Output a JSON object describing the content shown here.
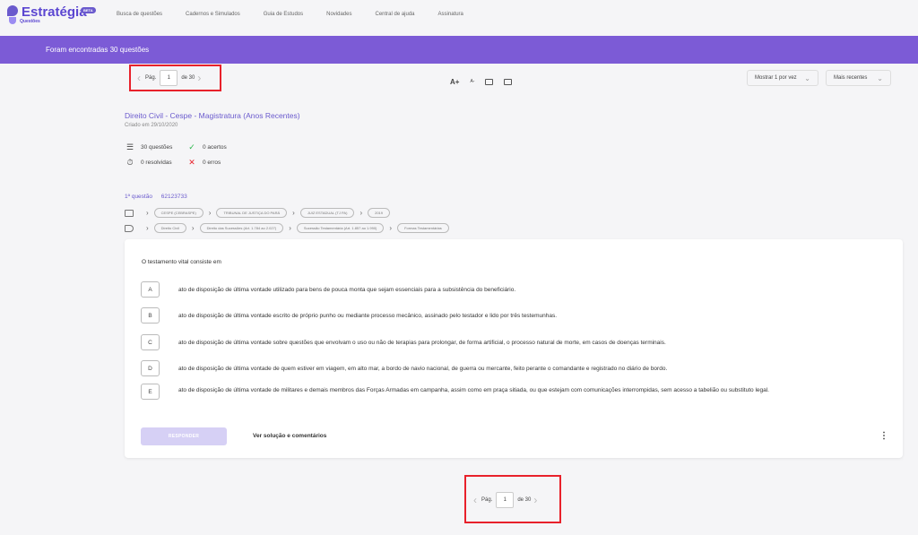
{
  "app": {
    "logo": "Estratégia",
    "logo_sub": "Questões",
    "beta": "BETA"
  },
  "nav": [
    "Busca de questões",
    "Cadernos e Simulados",
    "Guia de Estudos",
    "Novidades",
    "Central de ajuda",
    "Assinatura"
  ],
  "banner": {
    "text": "Foram encontradas 30 questões"
  },
  "pager_top": {
    "label": "Pág.",
    "value": "1",
    "total": "de 30"
  },
  "pager_bottom": {
    "label": "Pág.",
    "value": "1",
    "total": "de 30"
  },
  "tools": {
    "font_up": "A+",
    "font_down": "A-"
  },
  "controls": {
    "per_page": "Mostrar 1 por vez",
    "order": "Mais recentes"
  },
  "notebook": {
    "title": "Direito Civil - Cespe - Magistratura (Anos Recentes)",
    "date": "Criado em 29/10/2020",
    "questions": "30 questões",
    "hits": "0 acertos",
    "resolved": "0 resolvidas",
    "errors": "0 erros"
  },
  "question": {
    "number": "1ª questão",
    "id": "62123733",
    "tags1": [
      "CESPE (CEBRASPE)",
      "TRIBUNAL DE JUSTIÇA DO PARÁ",
      "JUIZ ESTADUAL (TJ PA)",
      "2019"
    ],
    "tags2": [
      "Direito Civil",
      "Direito das Sucessões (Art. 1.784 ao 2.027)",
      "Sucessão Testamentária (Art. 1.857 ao 1.990)",
      "Formas Testamentárias"
    ],
    "stem": "O testamento vital consiste em",
    "options": [
      {
        "letter": "A",
        "text": "ato de disposição de última vontade utilizado para bens de pouca monta que sejam essenciais para a subsistência do beneficiário."
      },
      {
        "letter": "B",
        "text": "ato de disposição de última vontade escrito de próprio punho ou mediante processo mecânico, assinado pelo testador e lido por três testemunhas."
      },
      {
        "letter": "C",
        "text": "ato de disposição de última vontade sobre questões que envolvam o uso ou não de terapias para prolongar, de forma artificial, o processo natural de morte, em casos de doenças terminais."
      },
      {
        "letter": "D",
        "text": "ato de disposição de última vontade de quem estiver em viagem, em alto mar, a bordo de navio nacional, de guerra ou mercante, feito perante o comandante e registrado no diário de bordo."
      },
      {
        "letter": "E",
        "text": "ato de disposição de última vontade de militares e demais membros das Forças Armadas em campanha, assim como em praça sitiada, ou que estejam com comunicações interrompidas, sem acesso a tabelião ou substituto legal."
      }
    ],
    "respond": "RESPONDER",
    "solution": "Ver solução e comentários"
  },
  "colors": {
    "accent": "#7c5bd6",
    "highlight": "#e8212b"
  }
}
